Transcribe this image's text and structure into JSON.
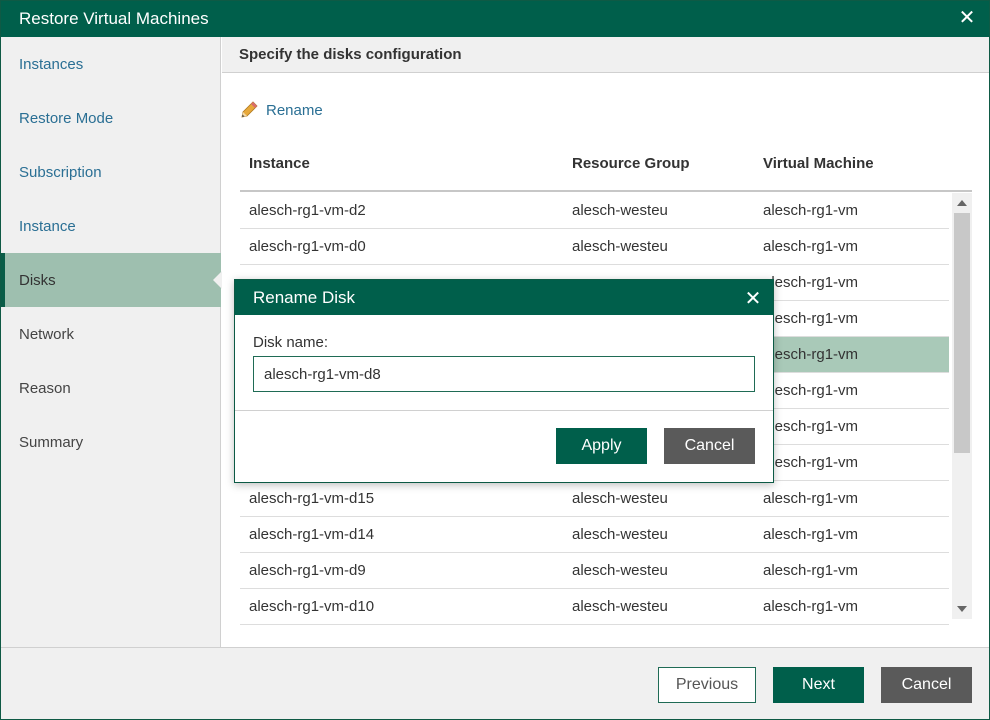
{
  "window": {
    "title": "Restore Virtual Machines"
  },
  "sidebar": {
    "items": [
      {
        "label": "Instances"
      },
      {
        "label": "Restore Mode"
      },
      {
        "label": "Subscription"
      },
      {
        "label": "Instance"
      },
      {
        "label": "Disks"
      },
      {
        "label": "Network"
      },
      {
        "label": "Reason"
      },
      {
        "label": "Summary"
      }
    ],
    "active": "Disks"
  },
  "main": {
    "header": "Specify the disks configuration",
    "rename_label": "Rename",
    "columns": [
      "Instance",
      "Resource Group",
      "Virtual Machine"
    ],
    "rows": [
      [
        "alesch-rg1-vm-d2",
        "alesch-westeu",
        "alesch-rg1-vm"
      ],
      [
        "alesch-rg1-vm-d0",
        "alesch-westeu",
        "alesch-rg1-vm"
      ],
      [
        "",
        "",
        "alesch-rg1-vm"
      ],
      [
        "",
        "",
        "alesch-rg1-vm"
      ],
      [
        "",
        "",
        "alesch-rg1-vm"
      ],
      [
        "",
        "",
        "alesch-rg1-vm"
      ],
      [
        "",
        "",
        "alesch-rg1-vm"
      ],
      [
        "",
        "",
        "alesch-rg1-vm"
      ],
      [
        "alesch-rg1-vm-d15",
        "alesch-westeu",
        "alesch-rg1-vm"
      ],
      [
        "alesch-rg1-vm-d14",
        "alesch-westeu",
        "alesch-rg1-vm"
      ],
      [
        "alesch-rg1-vm-d9",
        "alesch-westeu",
        "alesch-rg1-vm"
      ],
      [
        "alesch-rg1-vm-d10",
        "alesch-westeu",
        "alesch-rg1-vm"
      ]
    ],
    "selected_row": 4
  },
  "footer": {
    "previous": "Previous",
    "next": "Next",
    "cancel": "Cancel"
  },
  "modal": {
    "title": "Rename Disk",
    "label": "Disk name:",
    "value": "alesch-rg1-vm-d8",
    "apply": "Apply",
    "cancel": "Cancel"
  },
  "colors": {
    "brand": "#005f4b",
    "selected_row": "#a9c9b8",
    "link": "#2a6f94"
  }
}
